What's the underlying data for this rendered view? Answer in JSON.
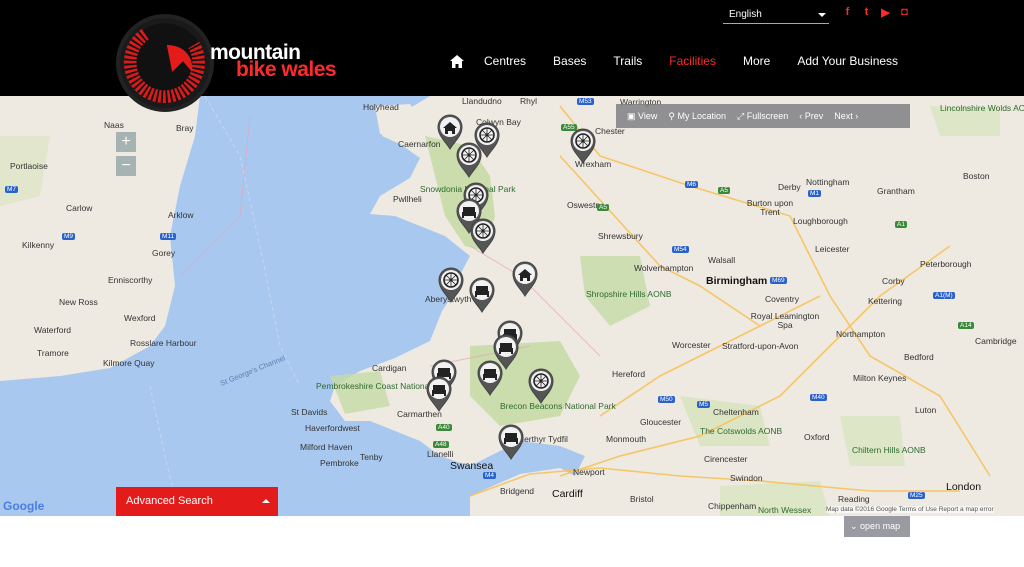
{
  "brand": {
    "line1": "mountain",
    "line2": "bike wales"
  },
  "language": {
    "selected": "English"
  },
  "social": [
    "facebook-icon",
    "twitter-icon",
    "youtube-icon",
    "instagram-icon"
  ],
  "social_glyphs": [
    "f",
    "t",
    "▶",
    "◘"
  ],
  "nav": {
    "items": [
      {
        "label": "Centres"
      },
      {
        "label": "Bases"
      },
      {
        "label": "Trails"
      },
      {
        "label": "Facilities",
        "active": true
      },
      {
        "label": "More"
      },
      {
        "label": "Add Your Business"
      }
    ]
  },
  "map_toolbar": {
    "view": "View",
    "my_location": "My Location",
    "fullscreen": "Fullscreen",
    "prev": "Prev",
    "next": "Next"
  },
  "zoom": {
    "in": "+",
    "out": "−"
  },
  "places": [
    "Holyhead",
    "Llandudno",
    "Rhyl",
    "Colwyn Bay",
    "Caernarfon",
    "Chester",
    "Warrington",
    "Wrexham",
    "Snowdonia National Park",
    "Pwllheli",
    "Oswestry",
    "Shrewsbury",
    "Aberystwyth",
    "Wolverhampton",
    "Walsall",
    "Birmingham",
    "Coventry",
    "Leicester",
    "Nottingham",
    "Derby",
    "Cardigan",
    "Pembrokeshire Coast National Park",
    "Carmarthen",
    "Haverfordwest",
    "Milford Haven",
    "Pembroke",
    "Tenby",
    "St Davids",
    "Swansea",
    "Llanelli",
    "Cardiff",
    "Bridgend",
    "Newport",
    "Hereford",
    "Worcester",
    "Gloucester",
    "Cheltenham",
    "Bristol",
    "Swindon",
    "Oxford",
    "Reading",
    "London",
    "Naas",
    "Carlow",
    "Kilkenny",
    "Wexford",
    "Waterford",
    "Portlaoise",
    "Bray",
    "Arklow",
    "Gorey",
    "Enniscorthy",
    "New Ross",
    "Rosslare Harbour",
    "Kilmore Quay",
    "Tramore",
    "Brecon Beacons National Park",
    "Merthyr Tydfil",
    "Monmouth",
    "Shropshire Hills AONB",
    "The Cotswolds AONB",
    "Chiltern Hills AONB",
    "North Wessex",
    "Lincolnshire Wolds AONB",
    "Grantham",
    "Boston",
    "Loughborough",
    "Peterborough",
    "Kettering",
    "Corby",
    "Northampton",
    "Bedford",
    "Cambridge",
    "Milton Keynes",
    "Luton",
    "Royal Leamington Spa",
    "Stratford-upon-Avon",
    "Burton upon Trent",
    "Cirencester",
    "Chippenham",
    "St George's Channel"
  ],
  "roads": [
    "M53",
    "A55",
    "M6",
    "A5",
    "M7",
    "M9",
    "M11",
    "M54",
    "M69",
    "A1",
    "M1",
    "A14",
    "M50",
    "M5",
    "M40",
    "M4",
    "A40",
    "A48",
    "M25",
    "A1(M)",
    "A5"
  ],
  "markers": [
    {
      "type": "home"
    },
    {
      "type": "wheel"
    },
    {
      "type": "wheel"
    },
    {
      "type": "wheel"
    },
    {
      "type": "wheel"
    },
    {
      "type": "bed"
    },
    {
      "type": "wheel"
    },
    {
      "type": "home"
    },
    {
      "type": "wheel"
    },
    {
      "type": "bed"
    },
    {
      "type": "bed"
    },
    {
      "type": "bed"
    },
    {
      "type": "bed"
    },
    {
      "type": "bed"
    },
    {
      "type": "bed"
    },
    {
      "type": "wheel"
    },
    {
      "type": "bed"
    }
  ],
  "map_footer": {
    "google": "Google",
    "attribution": "Map data ©2016 Google   Terms of Use   Report a map error"
  },
  "advanced_search": "Advanced Search",
  "open_map": "open map"
}
